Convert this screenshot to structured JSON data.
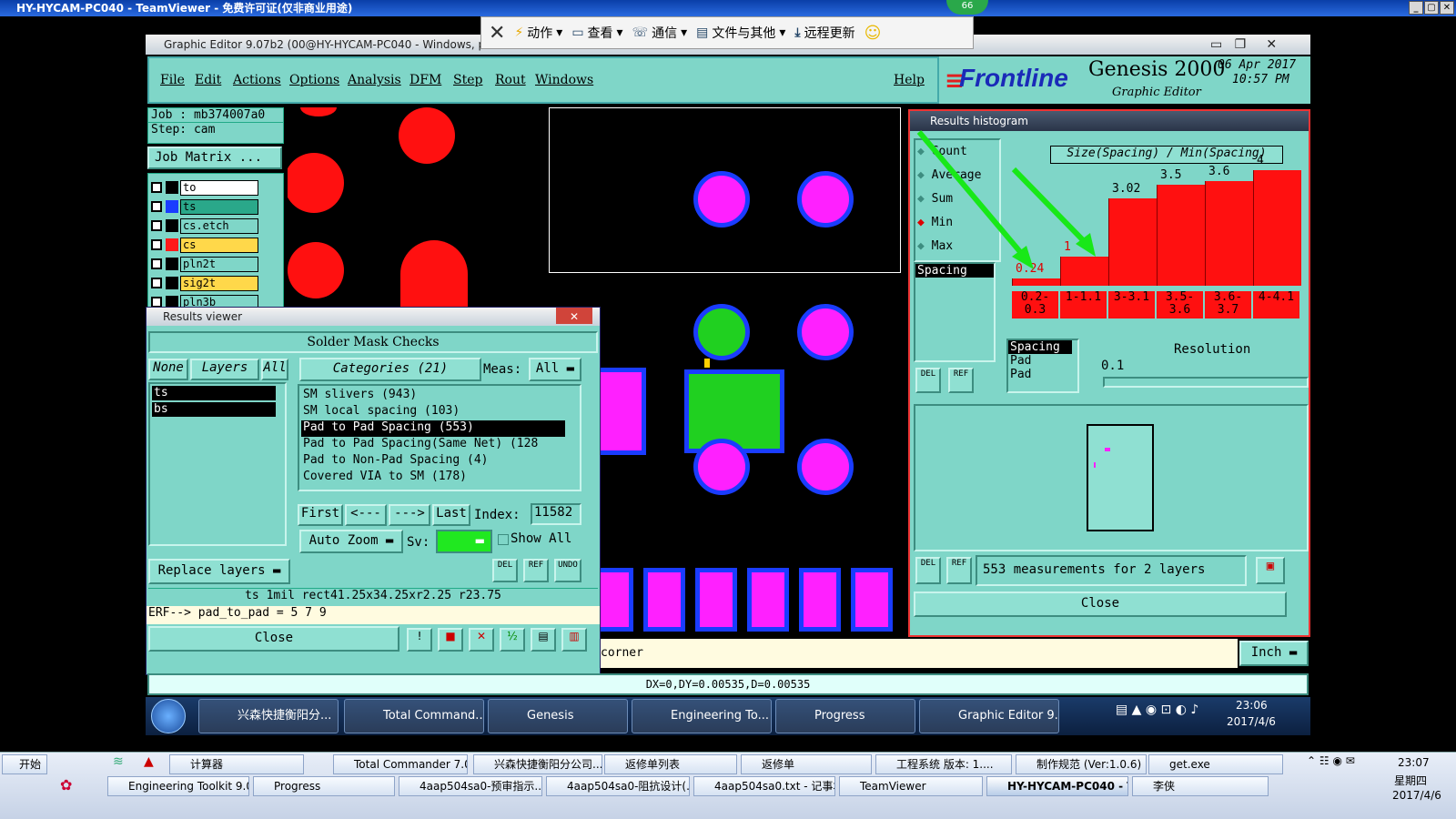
{
  "teamviewer": {
    "title": "HY-HYCAM-PC040 - TeamViewer - 免费许可证(仅非商业用途)",
    "badge": "66",
    "toolbar": {
      "actions": "动作",
      "view": "查看",
      "comm": "通信",
      "files": "文件与其他",
      "remote_update": "远程更新"
    }
  },
  "ge": {
    "title": "Graphic Editor 9.07b2 (00@HY-HYCAM-PC040 - Windows, p",
    "menu": [
      "File",
      "Edit",
      "Actions",
      "Options",
      "Analysis",
      "DFM",
      "Step",
      "Rout",
      "Windows"
    ],
    "help": "Help",
    "brand": "Frontline",
    "product": "Genesis 2000",
    "subtitle": "Graphic Editor",
    "date": "06 Apr 2017",
    "time": "10:57 PM",
    "job": "Job : mb374007a0",
    "step": "Step: cam",
    "job_matrix": "Job Matrix ...",
    "layers": [
      {
        "name": "to",
        "color": "#ffffff",
        "swatch": "#000000"
      },
      {
        "name": "ts",
        "color": "#2aa88a",
        "swatch": "#1a3cff"
      },
      {
        "name": "cs.etch",
        "color": "#7fd6c8",
        "swatch": "#000000"
      },
      {
        "name": "cs",
        "color": "#ffd84a",
        "swatch": "#ff1a1a"
      },
      {
        "name": "pln2t",
        "color": "#7fd6c8",
        "swatch": "#000000"
      },
      {
        "name": "sig2t",
        "color": "#ffd84a",
        "swatch": "#000000"
      },
      {
        "name": "pln3b",
        "color": "#7fd6c8",
        "swatch": "#000000"
      }
    ],
    "status_corner": "corner",
    "unit": "Inch",
    "coords": "DX=0,DY=0.00535,D=0.00535"
  },
  "results_viewer": {
    "title": "Results viewer",
    "heading": "Solder Mask Checks",
    "none": "None",
    "layers_btn": "Layers",
    "all": "All",
    "layer_list": [
      "ts",
      "bs"
    ],
    "categories": "Categories (21)",
    "meas_label": "Meas:",
    "meas_value": "All",
    "items": [
      "SM slivers (943)",
      "SM local spacing (103)",
      "Pad to Pad Spacing (553)",
      "Pad to Pad Spacing(Same Net) (128",
      "Pad to Non-Pad Spacing (4)",
      "Covered VIA to SM (178)"
    ],
    "selected_index": 2,
    "first": "First",
    "prev": "<---",
    "next": "--->",
    "last": "Last",
    "index_label": "Index:",
    "index_value": "11582",
    "auto_zoom": "Auto Zoom",
    "sv_label": "Sv:",
    "show_all": "Show All",
    "replace_layers": "Replace layers",
    "info_line": "ts 1mil  rect41.25x34.25xr2.25  r23.75",
    "erf_line": "ERF--> pad_to_pad = 5 7 9",
    "close": "Close",
    "del": "DEL",
    "ref": "REF",
    "undo": "UNDO"
  },
  "histogram": {
    "title": "Results histogram",
    "options": [
      "Count",
      "Average",
      "Sum",
      "Min",
      "Max"
    ],
    "selected_option": "Min",
    "chart_title": "Size(Spacing) / Min(Spacing)",
    "field_list": [
      "Spacing"
    ],
    "field_list2": [
      "Spacing",
      "Pad",
      "Pad"
    ],
    "resolution_label": "Resolution",
    "resolution_value": "0.1",
    "summary": "553 measurements for 2 layers",
    "close": "Close",
    "del": "DEL",
    "ref": "REF",
    "accent": "#ff1010"
  },
  "chart_data": {
    "type": "bar",
    "title": "Size(Spacing) / Min(Spacing)",
    "categories": [
      "0.2-0.3",
      "1-1.1",
      "3-3.1",
      "3.5-3.6",
      "3.6-3.7",
      "4-4.1"
    ],
    "values": [
      0.24,
      1,
      3.02,
      3.5,
      3.6,
      4
    ],
    "value_labels": [
      "0.24",
      "1",
      "3.02",
      "3.5",
      "3.6",
      "4"
    ],
    "ylim": [
      0,
      4.4
    ],
    "xlabel": "",
    "ylabel": ""
  },
  "inner_taskbar": [
    "兴森快捷衡阳分...",
    "Total Command...",
    "Genesis",
    "Engineering To...",
    "Progress",
    "Graphic Editor 9..."
  ],
  "inner_clock": {
    "time": "23:06",
    "date": "2017/4/6"
  },
  "outer_taskbar": {
    "start": "开始",
    "row1": [
      "计算器",
      "Total Commander 7.0 ...",
      "兴森快捷衡阳分公司...",
      "返修单列表",
      "返修单",
      "工程系统 版本: 1....",
      "制作规范 (Ver:1.0.6)",
      "get.exe"
    ],
    "row2": [
      "Engineering Toolkit 9.07...",
      "Progress",
      "4aap504sa0-预审指示...",
      "4aap504sa0-阻抗设计(...",
      "4aap504sa0.txt - 记事本",
      "TeamViewer",
      "HY-HYCAM-PC040 - T...",
      "李侠"
    ],
    "clock": {
      "time": "23:07",
      "weekday": "星期四",
      "date": "2017/4/6"
    }
  }
}
